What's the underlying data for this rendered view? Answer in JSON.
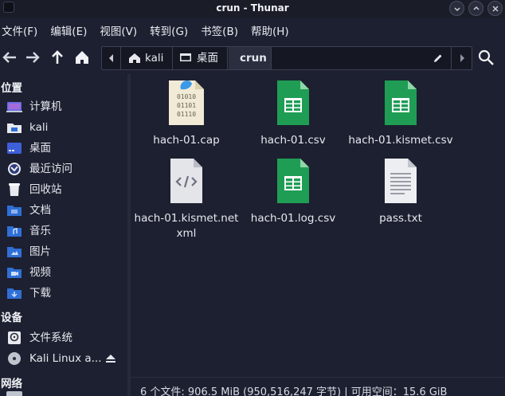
{
  "window": {
    "title": "crun - Thunar"
  },
  "menubar": {
    "items": [
      "文件(F)",
      "编辑(E)",
      "视图(V)",
      "转到(G)",
      "书签(B)",
      "帮助(H)"
    ]
  },
  "pathbar": {
    "crumbs": [
      "kali",
      "桌面",
      "crun"
    ]
  },
  "sidebar": {
    "places_heading": "位置",
    "places": [
      {
        "label": "计算机",
        "icon": "computer-icon"
      },
      {
        "label": "kali",
        "icon": "home-folder-icon"
      },
      {
        "label": "桌面",
        "icon": "desktop-icon"
      },
      {
        "label": "最近访问",
        "icon": "recent-icon"
      },
      {
        "label": "回收站",
        "icon": "trash-icon"
      },
      {
        "label": "文档",
        "icon": "documents-folder-icon"
      },
      {
        "label": "音乐",
        "icon": "music-folder-icon"
      },
      {
        "label": "图片",
        "icon": "pictures-folder-icon"
      },
      {
        "label": "视频",
        "icon": "videos-folder-icon"
      },
      {
        "label": "下载",
        "icon": "downloads-folder-icon"
      }
    ],
    "devices_heading": "设备",
    "devices": [
      {
        "label": "文件系统",
        "icon": "filesystem-icon"
      },
      {
        "label": "Kali Linux a...",
        "icon": "optical-disc-icon"
      }
    ],
    "network_heading": "网络"
  },
  "files": [
    {
      "name": "hach-01.cap",
      "icon": "binary-file-icon"
    },
    {
      "name": "hach-01.csv",
      "icon": "spreadsheet-icon"
    },
    {
      "name": "hach-01.kismet.csv",
      "icon": "spreadsheet-icon"
    },
    {
      "name": "hach-01.kismet.net xml",
      "icon": "xml-file-icon"
    },
    {
      "name": "hach-01.log.csv",
      "icon": "spreadsheet-icon"
    },
    {
      "name": "pass.txt",
      "icon": "text-file-icon"
    }
  ],
  "status": {
    "text": "6 个文件: 906.5 MiB (950,516,247 字节) | 可用空间：15.6 GiB"
  },
  "colors": {
    "background": "#1d2030",
    "sheet_green": "#1f9d55",
    "folder_blue": "#2f6fd6"
  }
}
